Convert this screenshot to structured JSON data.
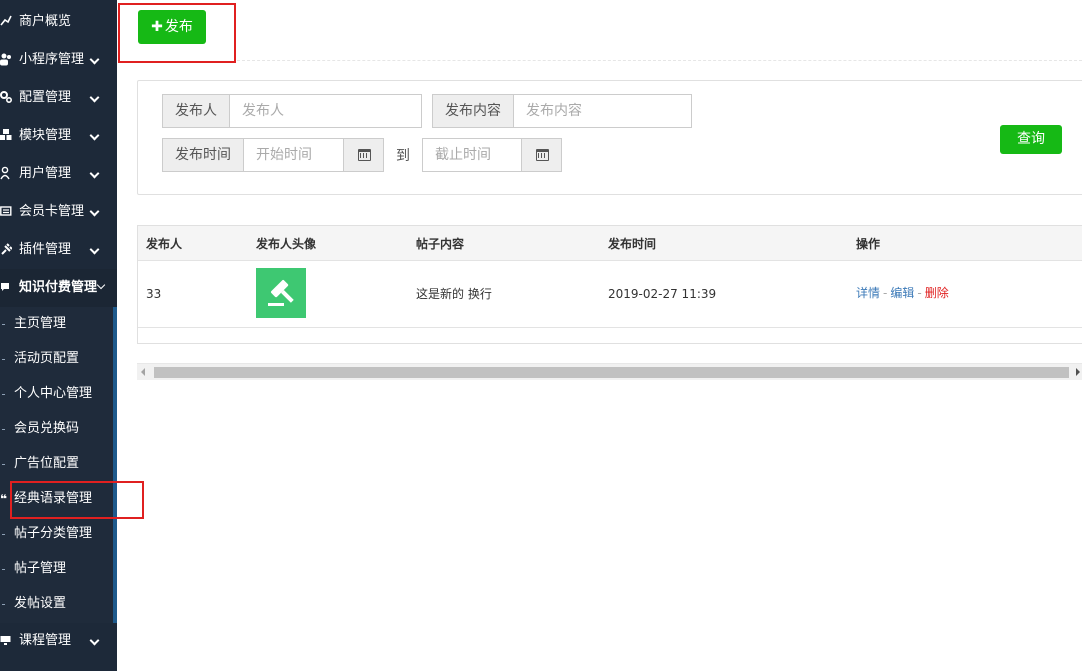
{
  "sidebar": {
    "items": [
      {
        "label": "商户概览",
        "icon": "chart-line-icon"
      },
      {
        "label": "小程序管理",
        "icon": "users-icon"
      },
      {
        "label": "配置管理",
        "icon": "cogs-icon"
      },
      {
        "label": "模块管理",
        "icon": "cubes-icon"
      },
      {
        "label": "用户管理",
        "icon": "user-icon"
      },
      {
        "label": "会员卡管理",
        "icon": "card-icon"
      },
      {
        "label": "插件管理",
        "icon": "plug-icon"
      },
      {
        "label": "知识付费管理",
        "icon": "chevron-down-icon"
      },
      {
        "label": "课程管理",
        "icon": "desktop-icon"
      }
    ],
    "subitems": [
      "主页管理",
      "活动页配置",
      "个人中心管理",
      "会员兑换码",
      "广告位配置",
      "经典语录管理",
      "帖子分类管理",
      "帖子管理",
      "发帖设置"
    ],
    "selected_icon": "quote-icon"
  },
  "toolbar": {
    "publish_label": "发布",
    "publish_icon": "plus-icon"
  },
  "search": {
    "publisher_label": "发布人",
    "publisher_placeholder": "发布人",
    "content_label": "发布内容",
    "content_placeholder": "发布内容",
    "time_label": "发布时间",
    "start_placeholder": "开始时间",
    "to_label": "到",
    "end_placeholder": "截止时间",
    "query_label": "查询"
  },
  "table": {
    "headers": [
      "发布人",
      "发布人头像",
      "帖子内容",
      "发布时间",
      "操作"
    ],
    "rows": [
      {
        "publisher": "33",
        "avatar_icon": "gavel-icon",
        "content": "这是新的 换行",
        "time": "2019-02-27 11:39",
        "actions": {
          "detail": "详情",
          "sep": "-",
          "edit": "编辑",
          "delete": "删除"
        }
      }
    ]
  },
  "colors": {
    "sidebar": "#1d2939",
    "primary_green": "#16b915",
    "link_blue": "#3c7ab8",
    "delete_red": "#e02020",
    "highlight": "#e02020"
  }
}
